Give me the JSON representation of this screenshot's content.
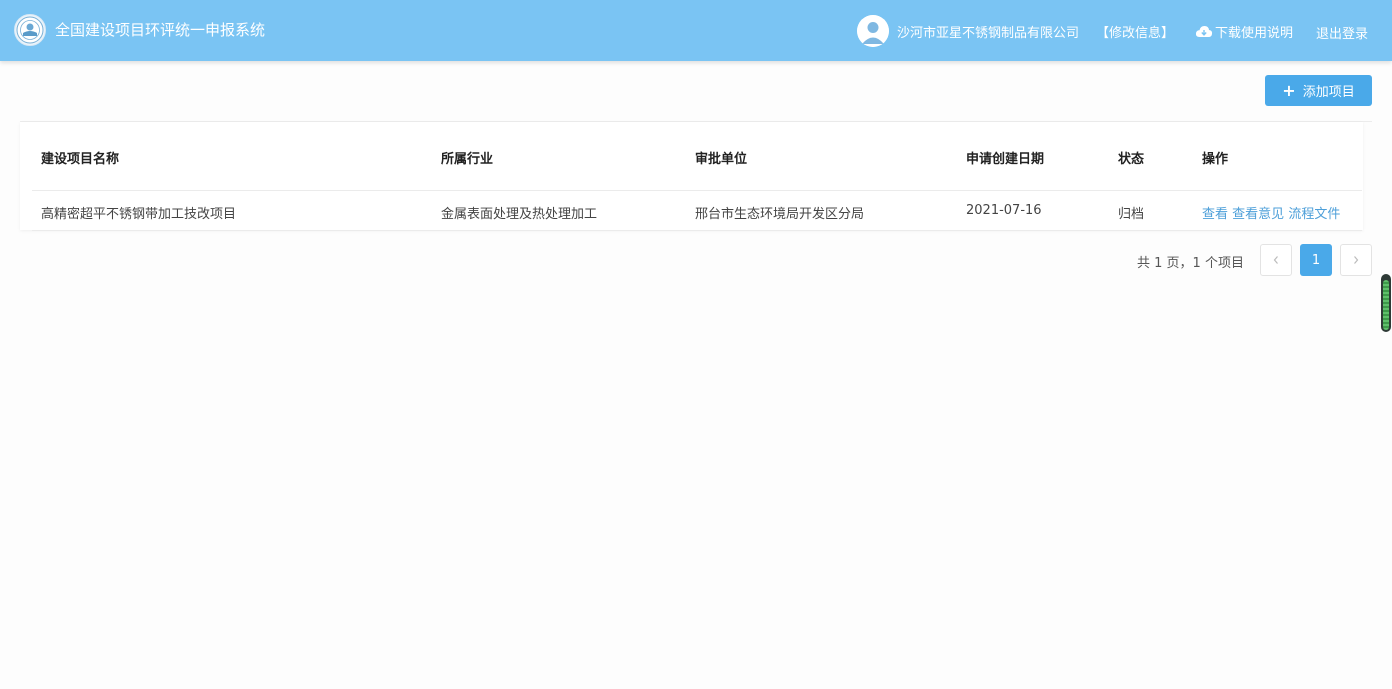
{
  "header": {
    "app_title": "全国建设项目环评统一申报系统",
    "company_name": "沙河市亚星不锈钢制品有限公司",
    "edit_info": "【修改信息】",
    "download_manual": "下载使用说明",
    "logout": "退出登录",
    "logo_icon": "emblem-logo-icon",
    "avatar_icon": "user-avatar-icon",
    "download_icon": "cloud-download-icon",
    "bar_color": "#7ac4f3"
  },
  "toolbar": {
    "add_project": "添加项目",
    "add_icon": "plus-icon",
    "button_color": "#4aa9e9"
  },
  "table": {
    "columns": [
      "建设项目名称",
      "所属行业",
      "审批单位",
      "申请创建日期",
      "状态",
      "操作"
    ],
    "rows": [
      {
        "name": "高精密超平不锈钢带加工技改项目",
        "industry": "金属表面处理及热处理加工",
        "approval_unit": "邢台市生态环境局开发区分局",
        "created_date": "2021-07-16",
        "status": "归档",
        "actions": [
          "查看",
          "查看意见",
          "流程文件"
        ]
      }
    ]
  },
  "pagination": {
    "summary": "共 1 页，1 个项目",
    "current_page": "1",
    "prev_icon": "chevron-left-icon",
    "next_icon": "chevron-right-icon"
  }
}
